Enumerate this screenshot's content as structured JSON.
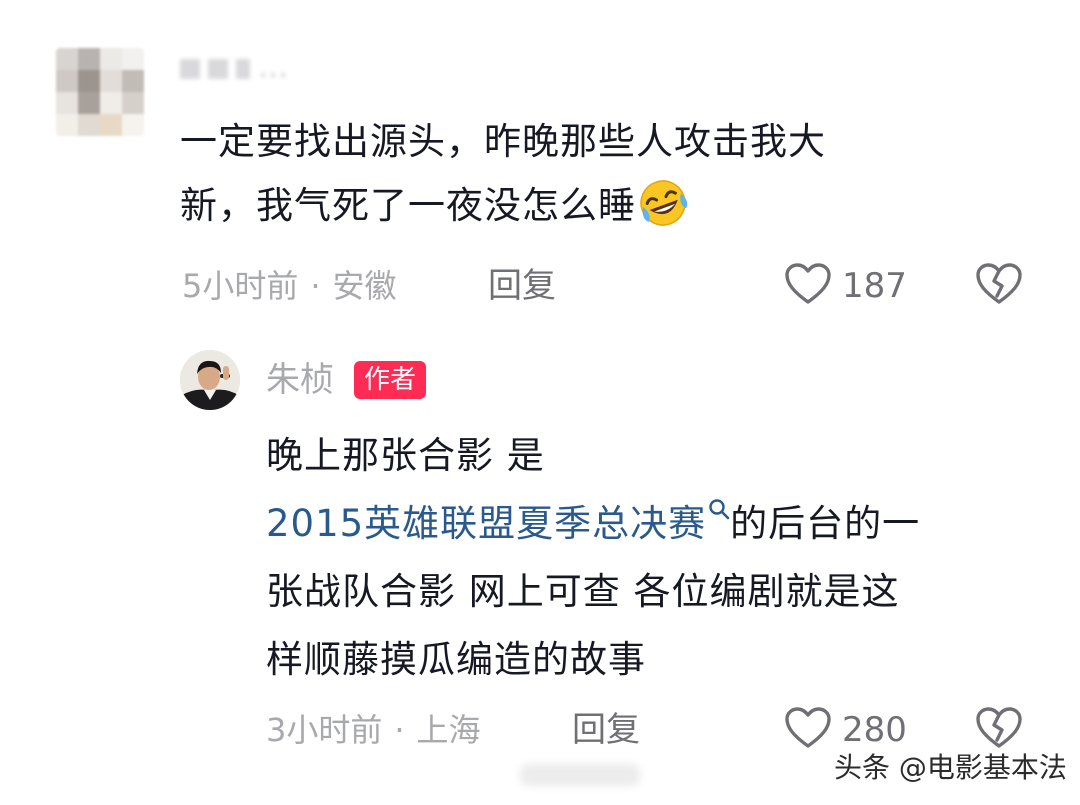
{
  "comment": {
    "username": "…",
    "text_line1": "一定要找出源头，昨晚那些人攻击我大",
    "text_line2": "新，我气死了一夜没怎么睡",
    "time": "5小时前",
    "location": "安徽",
    "reply_label": "回复",
    "likes": "187",
    "emoji": "rolling-laughing-emoji"
  },
  "reply": {
    "username": "朱桢",
    "badge": "作者",
    "line1": "晚上那张合影 是",
    "link_text": "2015英雄联盟夏季总决赛",
    "line2_rest": "的后台的一",
    "line3": "张战队合影 网上可查 各位编剧就是这",
    "line4": "样顺藤摸瓜编造的故事",
    "time": "3小时前",
    "location": "上海",
    "reply_label": "回复",
    "likes": "280"
  },
  "watermark": "头条 @电影基本法",
  "colors": {
    "accent": "#fe2c55",
    "link": "#2a5a8c",
    "meta": "#a8a9ad"
  }
}
